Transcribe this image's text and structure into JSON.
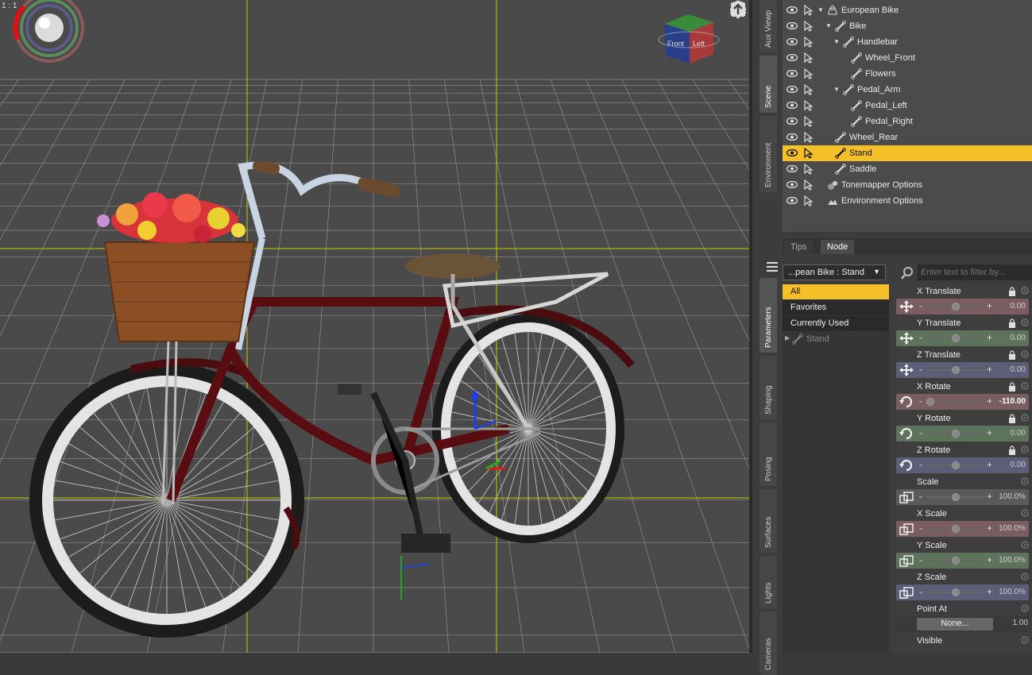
{
  "viewport": {
    "aspect_label": "1 : 1",
    "cube_front": "Front",
    "cube_left": "Left"
  },
  "side_tabs_top": [
    "Aux Viewp",
    "Scene",
    "Environment"
  ],
  "side_tabs_bottom": [
    "Parameters",
    "Shaping",
    "Posing",
    "Surfaces",
    "Lights",
    "Cameras"
  ],
  "scene": {
    "items": [
      {
        "label": "European Bike",
        "expanded": true,
        "icon": "figure-icon"
      },
      {
        "label": "Bike",
        "expanded": true,
        "icon": "bone-icon"
      },
      {
        "label": "Handlebar",
        "expanded": true,
        "icon": "bone-icon"
      },
      {
        "label": "Wheel_Front",
        "icon": "bone-icon"
      },
      {
        "label": "Flowers",
        "icon": "bone-icon"
      },
      {
        "label": "Pedal_Arm",
        "expanded": true,
        "icon": "bone-icon"
      },
      {
        "label": "Pedal_Left",
        "icon": "bone-icon"
      },
      {
        "label": "Pedal_Right",
        "icon": "bone-icon"
      },
      {
        "label": "Wheel_Rear",
        "icon": "bone-icon"
      },
      {
        "label": "Stand",
        "icon": "bone-icon",
        "selected": true
      },
      {
        "label": "Saddle",
        "icon": "bone-icon"
      },
      {
        "label": "Tonemapper Options",
        "icon": "tonemapper-icon"
      },
      {
        "label": "Environment Options",
        "icon": "environment-icon"
      }
    ]
  },
  "bottom_tabs": {
    "tips": "Tips",
    "node": "Node"
  },
  "parameters": {
    "node_selector": "...pean Bike : Stand",
    "filter_placeholder": "Enter text to filter by...",
    "groups": [
      "All",
      "Favorites",
      "Currently Used"
    ],
    "subgroup": "Stand",
    "items": [
      {
        "name": "X Translate",
        "value": "0.00",
        "kind": "translate",
        "color": "#7a5d63",
        "knob": 0.5,
        "locked": true
      },
      {
        "name": "Y Translate",
        "value": "0.00",
        "kind": "translate",
        "color": "#5e735c",
        "knob": 0.5,
        "locked": true
      },
      {
        "name": "Z Translate",
        "value": "0.00",
        "kind": "translate",
        "color": "#5c5e78",
        "knob": 0.5,
        "locked": true
      },
      {
        "name": "X Rotate",
        "value": "-110.00",
        "kind": "rotate",
        "color": "#7a5d63",
        "knob": 0.0,
        "locked": true,
        "bold": true
      },
      {
        "name": "Y Rotate",
        "value": "0.00",
        "kind": "rotate",
        "color": "#5e735c",
        "knob": 0.5,
        "locked": true
      },
      {
        "name": "Z Rotate",
        "value": "0.00",
        "kind": "rotate",
        "color": "#5c5e78",
        "knob": 0.5,
        "locked": true
      },
      {
        "name": "Scale",
        "value": "100.0%",
        "kind": "scale",
        "color": "#5a5a5a",
        "knob": 0.5
      },
      {
        "name": "X Scale",
        "value": "100.0%",
        "kind": "scale",
        "color": "#7a5d63",
        "knob": 0.5
      },
      {
        "name": "Y Scale",
        "value": "100.0%",
        "kind": "scale",
        "color": "#5e735c",
        "knob": 0.5
      },
      {
        "name": "Z Scale",
        "value": "100.0%",
        "kind": "scale",
        "color": "#5c5e78",
        "knob": 0.5
      }
    ],
    "point_at": {
      "name": "Point At",
      "button": "None...",
      "value": "1.00"
    },
    "visible": {
      "name": "Visible"
    }
  },
  "colors": {
    "selected": "#f5bf2a",
    "viewport_bg": "#4a4a4a",
    "grid": "#b9b9b9",
    "guide": "#c8c800"
  }
}
